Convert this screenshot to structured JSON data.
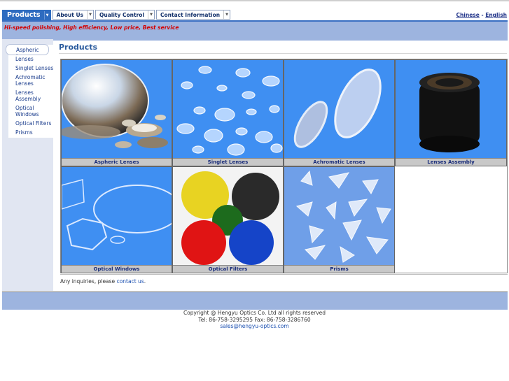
{
  "nav": {
    "items": [
      {
        "label": "Products"
      },
      {
        "label": "About Us"
      },
      {
        "label": "Quality Control"
      },
      {
        "label": "Contact Information"
      }
    ],
    "lang_chinese": "Chinese",
    "lang_sep": "-",
    "lang_english": "English"
  },
  "banner": {
    "tagline": "Hi-speed polishing, High efficiency, Low price, Best service"
  },
  "sidebar": {
    "items": [
      {
        "label": "Aspheric Lenses"
      },
      {
        "label": "Singlet Lenses"
      },
      {
        "label": "Achromatic Lenses"
      },
      {
        "label": "Lenses Assembly"
      },
      {
        "label": "Optical Windows"
      },
      {
        "label": "Optical Filters"
      },
      {
        "label": "Prisms"
      }
    ]
  },
  "main": {
    "title": "Products",
    "products": [
      {
        "label": "Aspheric Lenses"
      },
      {
        "label": "Singlet Lenses"
      },
      {
        "label": "Achromatic Lenses"
      },
      {
        "label": "Lenses Assembly"
      },
      {
        "label": "Optical Windows"
      },
      {
        "label": "Optical Filters"
      },
      {
        "label": "Prisms"
      }
    ],
    "inquiry_text": "Any inquiries, please",
    "inquiry_link": "contact us"
  },
  "footer": {
    "copyright": "Copyright @ Hengyu Optics Co. Ltd all rights reserved",
    "phone": "Tel: 86-758-3295295  Fax: 86-758-3286760",
    "email": "sales@hengyu-optics.com"
  },
  "colors": {
    "accent": "#2e6cc0",
    "banner": "#9db4df",
    "tagline": "#d40000",
    "product_bg": "#3f8ff2"
  }
}
